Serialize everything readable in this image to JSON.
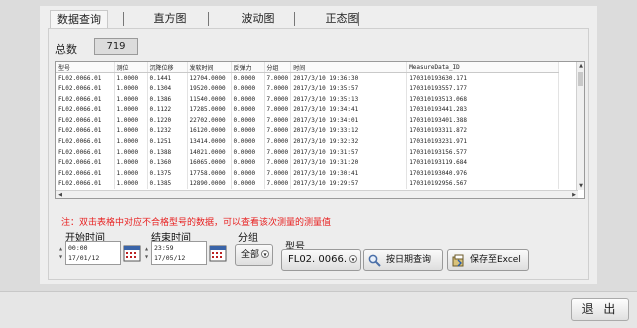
{
  "tabs": [
    {
      "label": "数据查询",
      "active": true
    },
    {
      "label": "直方图",
      "active": false
    },
    {
      "label": "波动图",
      "active": false
    },
    {
      "label": "正态图",
      "active": false
    }
  ],
  "summary": {
    "count_label": "总数",
    "count_value": "719"
  },
  "table": {
    "columns": [
      "型号",
      "测位",
      "沉降位移",
      "发软时间",
      "反弹力",
      "分组",
      "时间",
      "MeasureData_ID"
    ],
    "rows": [
      [
        "FL02.0066.01",
        "1.0000",
        "0.1441",
        "12704.0000",
        "0.0000",
        "7.0000",
        "2017/3/10 19:36:30",
        "170310193630.171"
      ],
      [
        "FL02.0066.01",
        "1.0000",
        "0.1304",
        "19520.0000",
        "0.0000",
        "7.0000",
        "2017/3/10 19:35:57",
        "170310193557.177"
      ],
      [
        "FL02.0066.01",
        "1.0000",
        "0.1386",
        "11540.0000",
        "0.0000",
        "7.0000",
        "2017/3/10 19:35:13",
        "170310193513.068"
      ],
      [
        "FL02.0066.01",
        "1.0000",
        "0.1122",
        "17285.0000",
        "0.0000",
        "7.0000",
        "2017/3/10 19:34:41",
        "170310193441.283"
      ],
      [
        "FL02.0066.01",
        "1.0000",
        "0.1220",
        "22702.0000",
        "0.0000",
        "7.0000",
        "2017/3/10 19:34:01",
        "170310193401.388"
      ],
      [
        "FL02.0066.01",
        "1.0000",
        "0.1232",
        "16120.0000",
        "0.0000",
        "7.0000",
        "2017/3/10 19:33:12",
        "170310193311.872"
      ],
      [
        "FL02.0066.01",
        "1.0000",
        "0.1251",
        "13414.0000",
        "0.0000",
        "7.0000",
        "2017/3/10 19:32:32",
        "170310193231.971"
      ],
      [
        "FL02.0066.01",
        "1.0000",
        "0.1388",
        "14021.0000",
        "0.0000",
        "7.0000",
        "2017/3/10 19:31:57",
        "170310193156.577"
      ],
      [
        "FL02.0066.01",
        "1.0000",
        "0.1360",
        "16065.0000",
        "0.0000",
        "7.0000",
        "2017/3/10 19:31:20",
        "170310193119.684"
      ],
      [
        "FL02.0066.01",
        "1.0000",
        "0.1375",
        "17758.0000",
        "0.0000",
        "7.0000",
        "2017/3/10 19:30:41",
        "170310193040.976"
      ],
      [
        "FL02.0066.01",
        "1.0000",
        "0.1385",
        "12890.0000",
        "0.0000",
        "7.0000",
        "2017/3/10 19:29:57",
        "170310192956.567"
      ]
    ]
  },
  "note": "注：双击表格中对应不合格型号的数据，可以查看该次测量的测量值",
  "filters": {
    "start_label": "开始时间",
    "start_time": "00:00",
    "start_date": "17/01/12",
    "end_label": "结束时间",
    "end_time": "23:59",
    "end_date": "17/05/12",
    "group_label": "分组",
    "group_value": "全部",
    "model_label": "型号",
    "model_value": "FL02. 0066."
  },
  "buttons": {
    "query_by_date": "按日期查询",
    "save_excel": "保存至Excel",
    "exit": "退 出"
  },
  "icons": {
    "calendar": "calendar-icon",
    "search": "magnifier-icon",
    "save": "save-icon"
  },
  "colors": {
    "note_text": "#e82020"
  }
}
